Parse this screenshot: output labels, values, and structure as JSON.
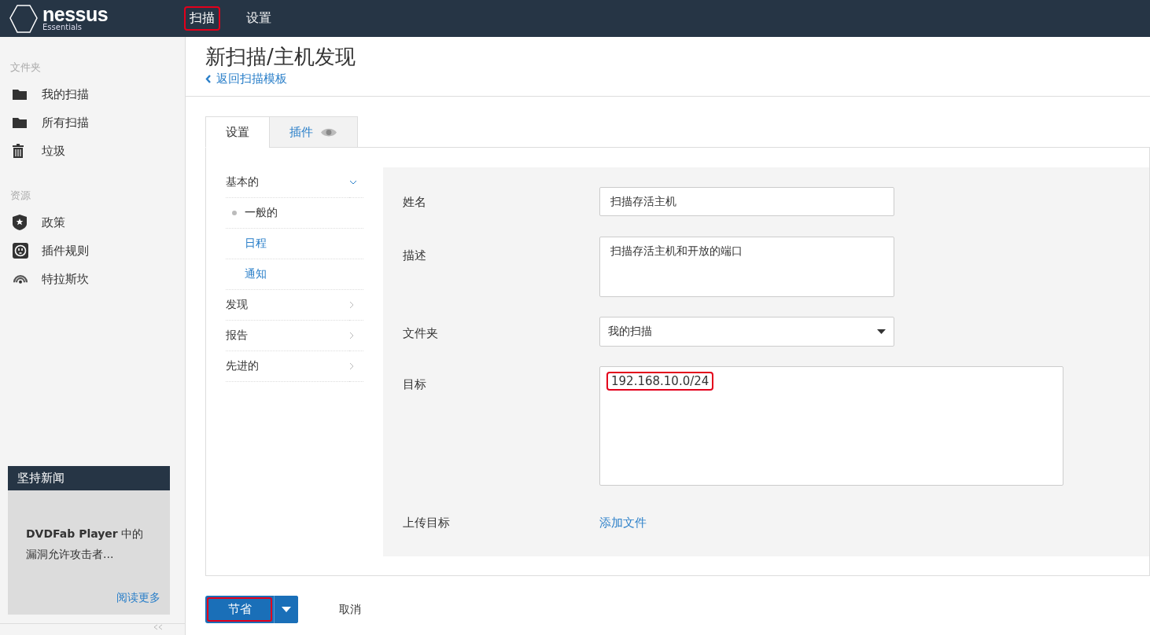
{
  "top_nav": {
    "logo": {
      "name": "nessus",
      "edition": "Essentials"
    },
    "items": [
      {
        "label": "扫描",
        "selected": true,
        "highlighted": true
      },
      {
        "label": "设置",
        "selected": false,
        "highlighted": false
      }
    ]
  },
  "sidebar": {
    "sections": [
      {
        "heading": "文件夹",
        "items": [
          {
            "label": "我的扫描"
          },
          {
            "label": "所有扫描"
          },
          {
            "label": "垃圾"
          }
        ]
      },
      {
        "heading": "资源",
        "items": [
          {
            "label": "政策"
          },
          {
            "label": "插件规则"
          },
          {
            "label": "特拉斯坎"
          }
        ]
      }
    ],
    "news": {
      "title": "坚持新闻",
      "text": "**DVDFab Player** 中的漏洞允许攻击者...",
      "link": "阅读更多"
    }
  },
  "page": {
    "title": "新扫描/主机发现",
    "back_link": "返回扫描模板"
  },
  "tabs": [
    {
      "label": "设置",
      "selected": true
    },
    {
      "label": "插件",
      "selected": false
    }
  ],
  "settings_menu": [
    {
      "label": "基本的",
      "expanded": true,
      "children": [
        {
          "label": "一般的",
          "selected": true
        },
        {
          "label": "日程",
          "selected": false
        },
        {
          "label": "通知",
          "selected": false
        }
      ]
    },
    {
      "label": "发现",
      "expanded": false
    },
    {
      "label": "报告",
      "expanded": false
    },
    {
      "label": "先进的",
      "expanded": false
    }
  ],
  "form": {
    "fields": [
      {
        "kind": "text",
        "label": "姓名",
        "value": "扫描存活主机"
      },
      {
        "kind": "textarea",
        "label": "描述",
        "value": "扫描存活主机和开放的端口"
      },
      {
        "kind": "select",
        "label": "文件夹",
        "value": "我的扫描"
      },
      {
        "kind": "targets",
        "label": "目标",
        "value": "192.168.10.0/24",
        "highlighted": true
      },
      {
        "kind": "link",
        "label": "上传目标",
        "value": "添加文件"
      }
    ]
  },
  "actions": {
    "save": {
      "label": "节省",
      "highlighted": true
    },
    "cancel": "取消"
  }
}
